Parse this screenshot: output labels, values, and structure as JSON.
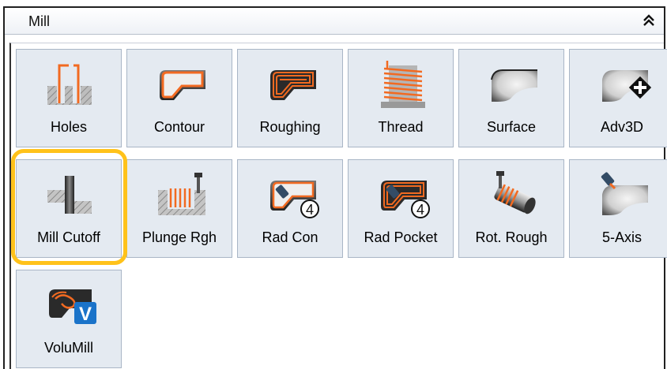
{
  "panel": {
    "title": "Mill",
    "collapse_icon": "double-chevron-up-icon"
  },
  "tiles": [
    {
      "label": "Holes",
      "icon": "holes-icon"
    },
    {
      "label": "Contour",
      "icon": "contour-icon"
    },
    {
      "label": "Roughing",
      "icon": "roughing-icon"
    },
    {
      "label": "Thread",
      "icon": "thread-icon"
    },
    {
      "label": "Surface",
      "icon": "surface-icon"
    },
    {
      "label": "Adv3D",
      "icon": "adv3d-icon"
    },
    {
      "label": "Mill Cutoff",
      "icon": "mill-cutoff-icon"
    },
    {
      "label": "Plunge Rgh",
      "icon": "plunge-rough-icon"
    },
    {
      "label": "Rad Con",
      "icon": "rad-con-icon",
      "badge": "4"
    },
    {
      "label": "Rad Pocket",
      "icon": "rad-pocket-icon",
      "badge": "4"
    },
    {
      "label": "Rot. Rough",
      "icon": "rot-rough-icon"
    },
    {
      "label": "5-Axis",
      "icon": "five-axis-icon"
    },
    {
      "label": "VoluMill",
      "icon": "volumill-icon",
      "badge": "V"
    }
  ],
  "highlight_color": "#ffc21a",
  "accent_color": "#f26a21",
  "tile_color": "#e4eaf1"
}
